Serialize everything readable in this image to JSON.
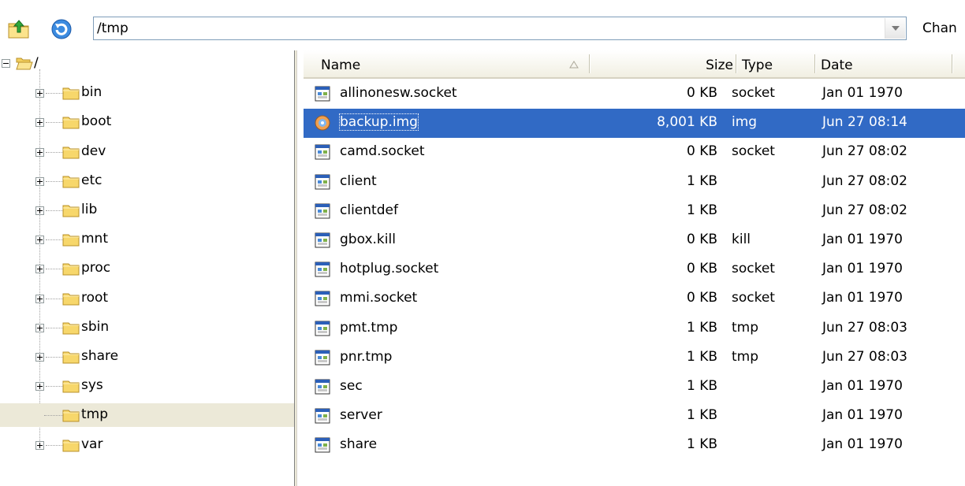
{
  "toolbar": {
    "up_icon": "folder-up-icon",
    "refresh_icon": "refresh-icon",
    "path_value": "/tmp",
    "change_label": "Chan"
  },
  "tree": {
    "root_label": "/",
    "items": [
      {
        "label": "bin"
      },
      {
        "label": "boot"
      },
      {
        "label": "dev"
      },
      {
        "label": "etc"
      },
      {
        "label": "lib"
      },
      {
        "label": "mnt"
      },
      {
        "label": "proc"
      },
      {
        "label": "root"
      },
      {
        "label": "sbin"
      },
      {
        "label": "share"
      },
      {
        "label": "sys"
      },
      {
        "label": "tmp",
        "selected": true
      },
      {
        "label": "var"
      }
    ]
  },
  "list": {
    "columns": {
      "name": "Name",
      "size": "Size",
      "type": "Type",
      "date": "Date"
    },
    "sort_column": "name",
    "rows": [
      {
        "name": "allinonesw.socket",
        "size": "0 KB",
        "type": "socket",
        "date": "Jan 01 1970"
      },
      {
        "name": "backup.img",
        "size": "8,001 KB",
        "type": "img",
        "date": "Jun 27 08:14",
        "selected": true
      },
      {
        "name": "camd.socket",
        "size": "0 KB",
        "type": "socket",
        "date": "Jun 27 08:02"
      },
      {
        "name": "client",
        "size": "1 KB",
        "type": "",
        "date": "Jun 27 08:02"
      },
      {
        "name": "clientdef",
        "size": "1 KB",
        "type": "",
        "date": "Jun 27 08:02"
      },
      {
        "name": "gbox.kill",
        "size": "0 KB",
        "type": "kill",
        "date": "Jan 01 1970"
      },
      {
        "name": "hotplug.socket",
        "size": "0 KB",
        "type": "socket",
        "date": "Jan 01 1970"
      },
      {
        "name": "mmi.socket",
        "size": "0 KB",
        "type": "socket",
        "date": "Jan 01 1970"
      },
      {
        "name": "pmt.tmp",
        "size": "1 KB",
        "type": "tmp",
        "date": "Jun 27 08:03"
      },
      {
        "name": "pnr.tmp",
        "size": "1 KB",
        "type": "tmp",
        "date": "Jun 27 08:03"
      },
      {
        "name": "sec",
        "size": "1 KB",
        "type": "",
        "date": "Jan 01 1970"
      },
      {
        "name": "server",
        "size": "1 KB",
        "type": "",
        "date": "Jan 01 1970"
      },
      {
        "name": "share",
        "size": "1 KB",
        "type": "",
        "date": "Jan 01 1970"
      }
    ]
  },
  "colors": {
    "selection": "#316ac5",
    "tree_selection": "#ece9d8",
    "folder": "#f7d76b"
  }
}
